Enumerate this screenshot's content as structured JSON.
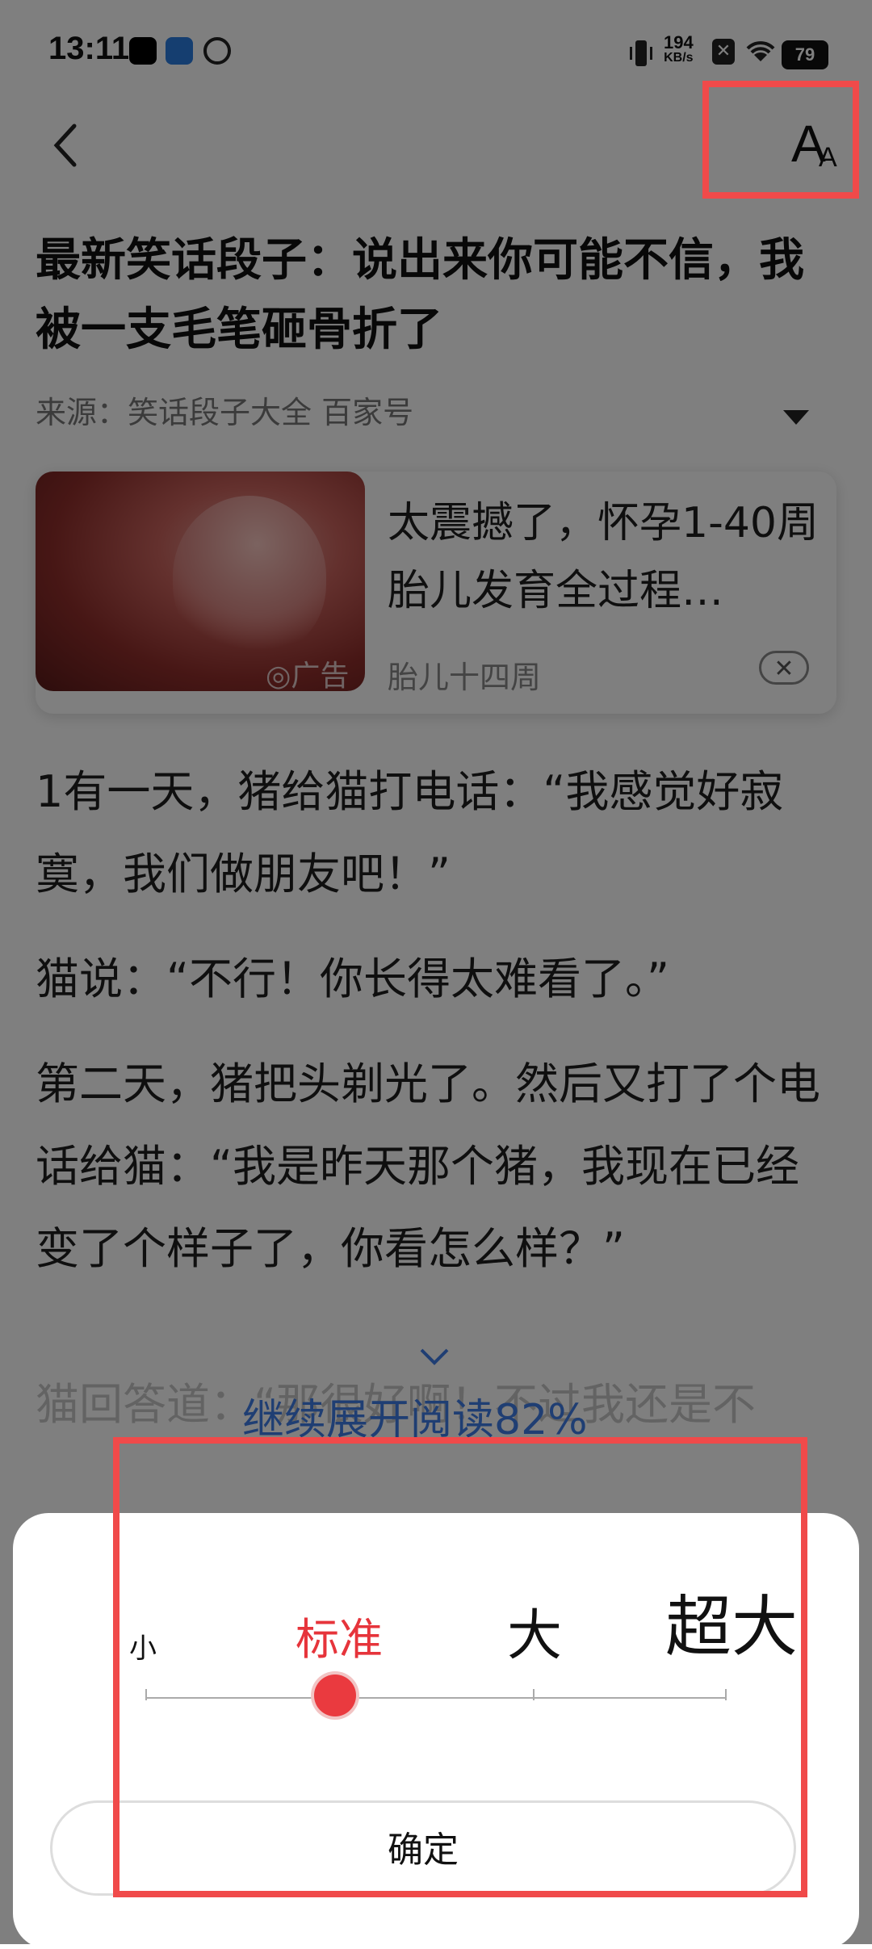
{
  "status_bar": {
    "time": "13:11",
    "speed_value": "194",
    "speed_unit": "KB/s",
    "battery": "79"
  },
  "article": {
    "title": "最新笑话段子：说出来你可能不信，我被一支毛笔砸骨折了",
    "source": "来源：笑话段子大全 百家号",
    "paragraphs": [
      "1有一天，猪给猫打电话：“我感觉好寂寞，我们做朋友吧！”",
      "猫说：“不行！你长得太难看了。”",
      "第二天，猪把头剃光了。然后又打了个电话给猫：“我是昨天那个猪，我现在已经变了个样子了，你看怎么样？”"
    ],
    "cut_line": "猫回答道：“那很好啊！不过我还是不",
    "expand_label": "继续展开阅读82%"
  },
  "ad": {
    "title": "太震撼了，怀孕1-40周胎儿发育全过程…",
    "badge": "◎广告",
    "subtitle": "胎儿十四周",
    "close_label": "✕",
    "icon": "close-icon"
  },
  "font_panel": {
    "sizes": [
      "小",
      "标准",
      "大",
      "超大"
    ],
    "selected": "标准",
    "selected_index": 1,
    "confirm_label": "确定",
    "accent_color": "#e6343b"
  },
  "colors": {
    "highlight": "#f04a4a",
    "link": "#3f7ce6"
  }
}
